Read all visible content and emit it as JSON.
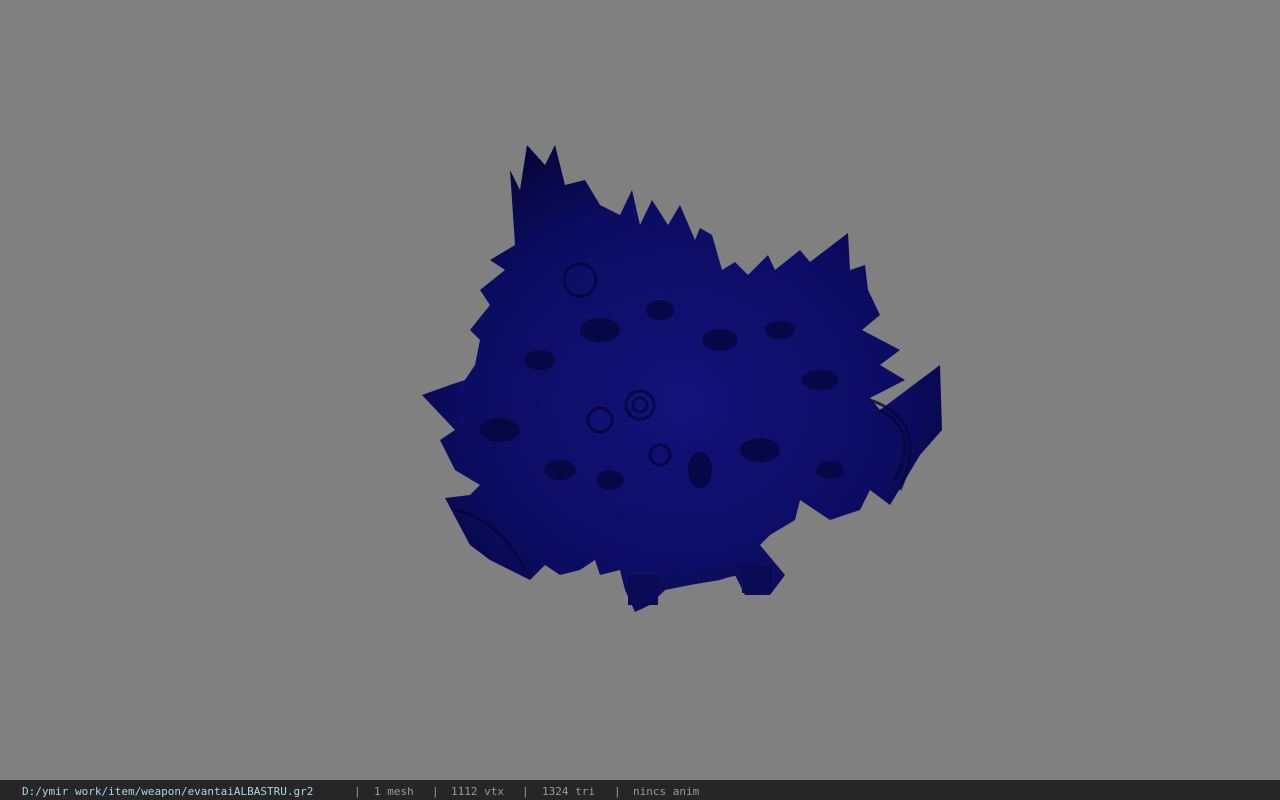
{
  "viewport": {
    "background_color": "#808080",
    "model_color": "#0d0d6e",
    "model_shadow_color": "#05053a"
  },
  "statusbar": {
    "file_path": "D:/ymir work/item/weapon/evantaiALBASTRU.gr2",
    "separator": "|",
    "mesh_count": "1 mesh",
    "vertex_count": "1112 vtx",
    "triangle_count": "1324 tri",
    "animation": "nincs anim"
  }
}
